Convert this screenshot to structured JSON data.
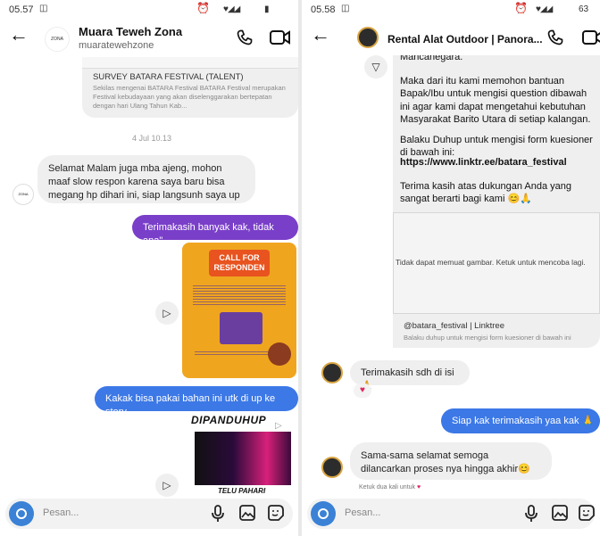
{
  "left": {
    "status_time": "05.57",
    "header": {
      "title": "Muara Teweh Zona",
      "username": "muaratewehzone",
      "avatar_text": "ZONA"
    },
    "survey_card": {
      "title": "SURVEY BATARA FESTIVAL (TALENT)",
      "desc": "Sekilas mengenai BATARA Festival BATARA Festival merupakan Festival kebudayaan yang akan diselenggarakan bertepatan dengan hari Ulang Tahun Kab..."
    },
    "date_separator": "4 Jul 10.13",
    "messages": [
      {
        "text": "Selamat Malam juga mba ajeng, mohon maaf slow respon karena saya baru bisa megang hp dihari ini, siap langsunh saya up"
      },
      {
        "text": "Terimakasih banyak kak, tidak apa\""
      },
      {
        "text": "Kakak bisa pakai bahan ini utk di up ke story"
      }
    ],
    "poster": {
      "title": "CALL FOR RESPONDEN"
    },
    "story_card": {
      "title": "DIPANDUHUP",
      "subtitle": "TELU PAHARI"
    },
    "composer_placeholder": "Pesan..."
  },
  "right": {
    "status_time": "05.58",
    "status_battery": "63",
    "header": {
      "title": "Rental Alat Outdoor | Panora..."
    },
    "message_text": {
      "line0": "Mancanegara.",
      "p1": "Maka dari itu kami memohon bantuan Bapak/Ibu untuk mengisi question dibawah ini agar kami dapat mengetahui kebutuhan Masyarakat Barito Utara di setiap kalangan.",
      "p2": "Balaku Duhup untuk mengisi form kuesioner di bawah ini:",
      "link": "https://www.linktr.ee/batara_festival",
      "p3": "Terima kasih atas dukungan Anda yang sangat berarti bagi kami"
    },
    "image_error": "Tidak dapat memuat gambar. Ketuk untuk mencoba lagi.",
    "link_card": {
      "title": "@batara_festival | Linktree",
      "desc": "Balaku duhup untuk mengisi form kuesioner di bawah ini"
    },
    "messages": [
      {
        "text": "Terimakasih sdh di isi"
      },
      {
        "text": "Siap kak terimakasih yaa kak"
      },
      {
        "text": "Sama-sama selamat semoga dilancarkan proses nya hingga akhir"
      }
    ],
    "reaction_note": "Ketuk dua kali untuk",
    "composer_placeholder": "Pesan..."
  },
  "colors": {
    "purple": "#7a3fc9",
    "blue": "#3c78e6",
    "poster_orange": "#f0a51f"
  }
}
